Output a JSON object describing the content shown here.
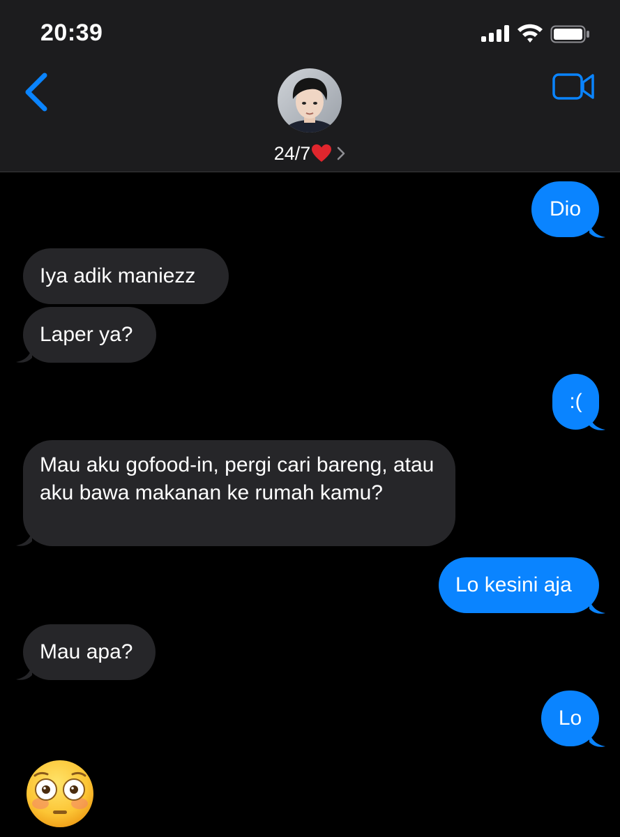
{
  "status_bar": {
    "time": "20:39",
    "icons": [
      "signal-icon",
      "wifi-icon",
      "battery-icon"
    ]
  },
  "header": {
    "contact_name": "24/7",
    "contact_emoji": "heart-icon",
    "left_icon": "chevron-left-icon",
    "right_icon": "video-camera-icon"
  },
  "messages": [
    {
      "dir": "out",
      "text": "Dio"
    },
    {
      "dir": "in",
      "text": "Iya adik maniezz"
    },
    {
      "dir": "in",
      "text": "Laper ya?"
    },
    {
      "dir": "out",
      "text": ":("
    },
    {
      "dir": "in",
      "text": "Mau aku gofood-in, pergi cari bareng, atau aku bawa makanan ke rumah kamu?"
    },
    {
      "dir": "out",
      "text": "Lo kesini aja"
    },
    {
      "dir": "in",
      "text": "Mau apa?"
    },
    {
      "dir": "out",
      "text": "Lo"
    }
  ],
  "reaction_emoji": "flushed-face-icon",
  "colors": {
    "header_bg": "#1c1c1e",
    "incoming_bubble": "#262629",
    "outgoing_bubble": "#0a84ff",
    "accent": "#0a84ff"
  }
}
